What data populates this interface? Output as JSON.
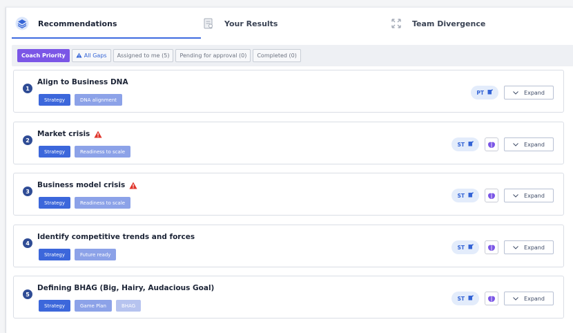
{
  "tabs": [
    {
      "label": "Recommendations",
      "icon": "layers-icon",
      "active": true
    },
    {
      "label": "Your Results",
      "icon": "results-doc-icon",
      "active": false
    },
    {
      "label": "Team Divergence",
      "icon": "arrows-out-icon",
      "active": false
    }
  ],
  "filters": [
    {
      "label": "Coach Priority",
      "active": true
    },
    {
      "label": "All Gaps",
      "icon": "warning-icon"
    },
    {
      "label": "Assigned to me (5)"
    },
    {
      "label": "Pending for approval (0)"
    },
    {
      "label": "Completed (0)"
    }
  ],
  "expand_label": "Expand",
  "colors": {
    "accent_blue": "#3c67db",
    "accent_purple": "#7b56e6",
    "warning_red": "#e0352b",
    "badge_navy": "#2f4c95"
  },
  "cards": [
    {
      "num": "1",
      "title": "Align to Business DNA",
      "warning": false,
      "tags": [
        "Strategy",
        "DNA alignment"
      ],
      "initials": "PT",
      "ai": false
    },
    {
      "num": "2",
      "title": "Market crisis",
      "warning": true,
      "tags": [
        "Strategy",
        "Readiness to scale"
      ],
      "initials": "ST",
      "ai": true
    },
    {
      "num": "3",
      "title": "Business model crisis",
      "warning": true,
      "tags": [
        "Strategy",
        "Readiness to scale"
      ],
      "initials": "ST",
      "ai": true
    },
    {
      "num": "4",
      "title": "Identify competitive trends and forces",
      "warning": false,
      "tags": [
        "Strategy",
        "Future ready"
      ],
      "initials": "ST",
      "ai": true
    },
    {
      "num": "5",
      "title": "Defining BHAG (Big, Hairy, Audacious Goal)",
      "warning": false,
      "tags": [
        "Strategy",
        "Game Plan",
        "BHAG"
      ],
      "initials": "ST",
      "ai": true
    }
  ]
}
